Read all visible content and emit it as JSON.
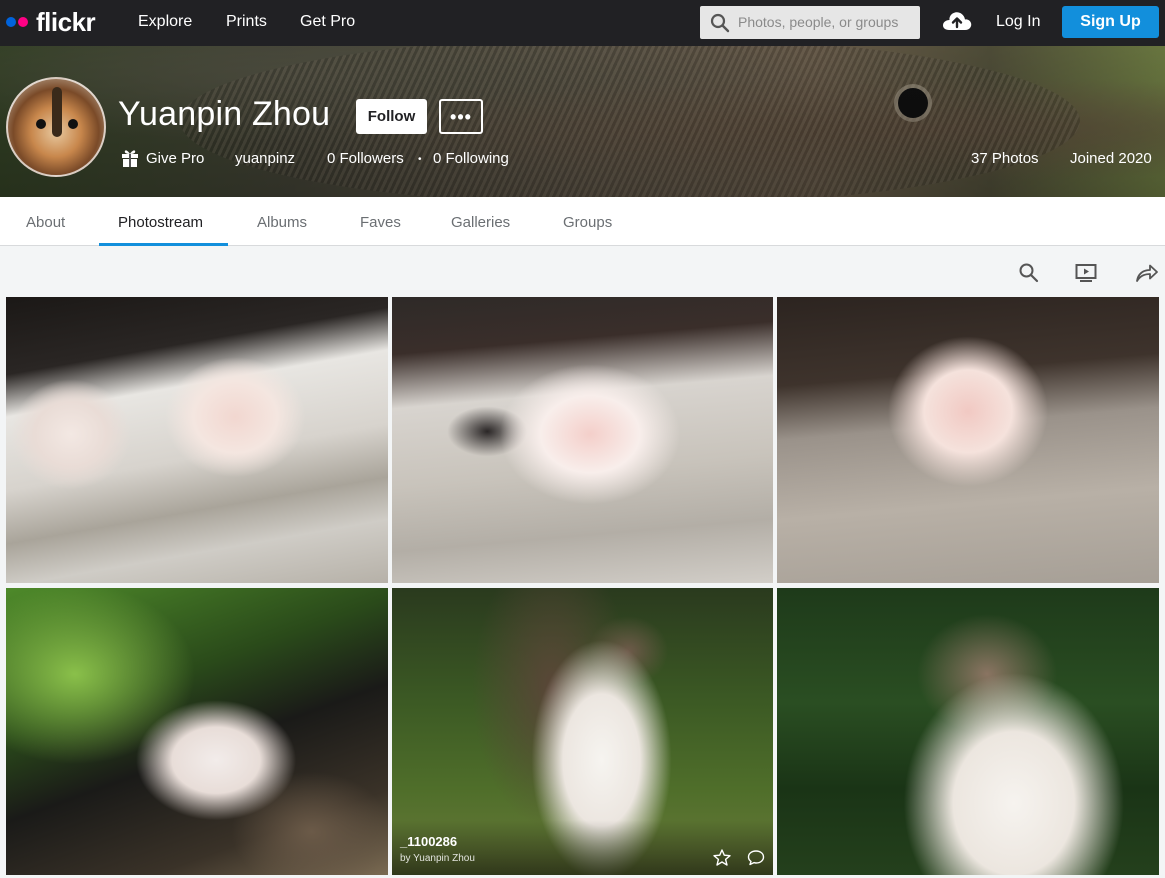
{
  "nav": {
    "logo": "flickr",
    "links": [
      "Explore",
      "Prints",
      "Get Pro"
    ],
    "search_placeholder": "Photos, people, or groups",
    "login": "Log In",
    "signup": "Sign Up"
  },
  "profile": {
    "name": "Yuanpin Zhou",
    "follow": "Follow",
    "more": "•••",
    "give_pro": "Give Pro",
    "handle": "yuanpinz",
    "followers": "0 Followers",
    "separator": "•",
    "following": "0 Following",
    "photos": "37 Photos",
    "joined": "Joined 2020"
  },
  "tabs": [
    "About",
    "Photostream",
    "Albums",
    "Faves",
    "Galleries",
    "Groups"
  ],
  "active_tab": "Photostream",
  "toolbar_icons": [
    "search-icon",
    "slideshow-icon",
    "share-icon"
  ],
  "hover_photo": {
    "title": "_1100286",
    "byline": "by Yuanpin Zhou"
  },
  "colors": {
    "nav_bg": "#212124",
    "accent": "#128fdc",
    "logo_blue": "#0063dc",
    "logo_pink": "#ff0084"
  }
}
